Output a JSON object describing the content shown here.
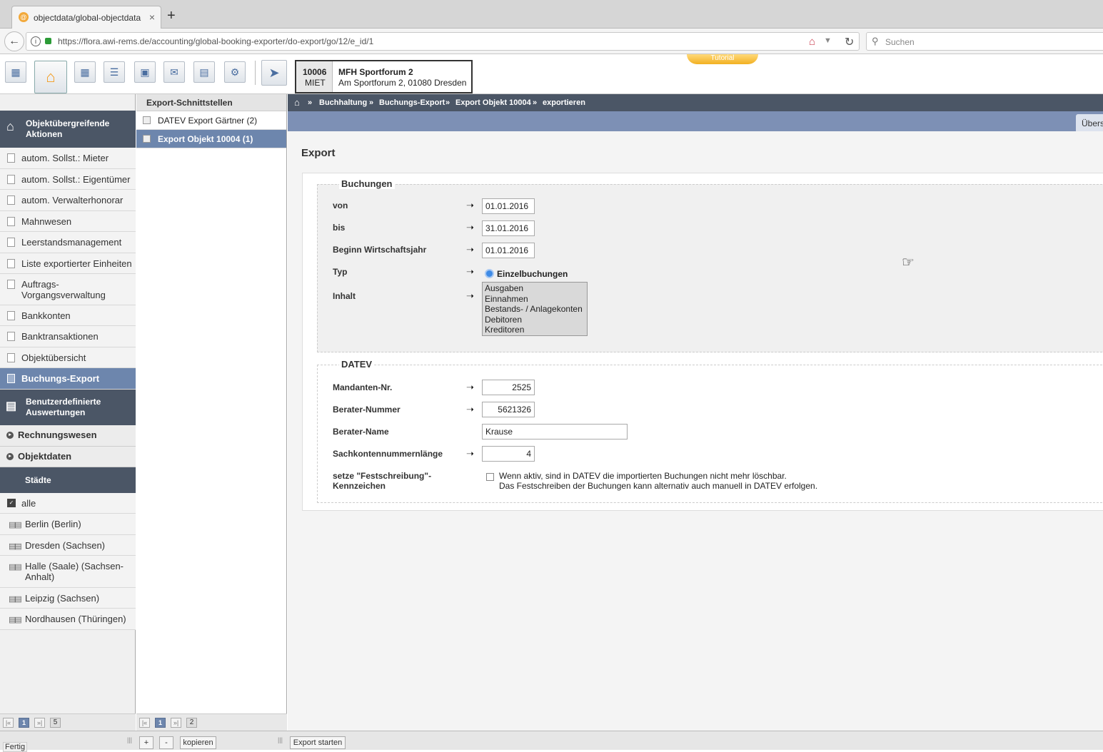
{
  "browser": {
    "tab_title": "objectdata/global-objectdata",
    "tab_close": "×",
    "new_tab": "+",
    "url": "https://flora.awi-rems.de/accounting/global-booking-exporter/do-export/go/12/e_id/1",
    "search_placeholder": "Suchen"
  },
  "toolbar": {
    "tutorial_label": "Tutorial",
    "object": {
      "id": "10006",
      "type": "MIET",
      "name": "MFH Sportforum 2",
      "address": "Am Sportforum 2, 01080 Dresden"
    }
  },
  "leftnav": {
    "group1_title": "Objektübergreifende Aktionen",
    "items": [
      {
        "label": "autom. Sollst.: Mieter"
      },
      {
        "label": "autom. Sollst.: Eigentümer"
      },
      {
        "label": "autom. Verwalterhonorar"
      },
      {
        "label": "Mahnwesen"
      },
      {
        "label": "Leerstandsmanagement"
      },
      {
        "label": "Liste exportierter Einheiten"
      },
      {
        "label": "Auftrags-Vorgangsverwaltung"
      },
      {
        "label": "Bankkonten"
      },
      {
        "label": "Banktransaktionen"
      },
      {
        "label": "Objektübersicht"
      },
      {
        "label": "Buchungs-Export"
      }
    ],
    "group2_title": "Benutzerdefinierte Auswertungen",
    "sections": [
      {
        "label": "Rechnungswesen"
      },
      {
        "label": "Objektdaten"
      }
    ],
    "cities_header": "Städte",
    "cities_all": "alle",
    "cities": [
      {
        "label": "Berlin (Berlin)"
      },
      {
        "label": "Dresden (Sachsen)"
      },
      {
        "label": "Halle (Saale) (Sachsen-Anhalt)"
      },
      {
        "label": "Leipzig (Sachsen)"
      },
      {
        "label": "Nordhausen (Thüringen)"
      }
    ],
    "pager": {
      "first": "|«",
      "current": "1",
      "last": "»|",
      "total": "5"
    }
  },
  "midpanel": {
    "header": "Export-Schnittstellen",
    "items": [
      {
        "label": "DATEV Export Gärtner (2)"
      },
      {
        "label": "Export Objekt 10004 (1)"
      }
    ],
    "pager": {
      "first": "|«",
      "current": "1",
      "last": "»|",
      "total": "2"
    }
  },
  "content": {
    "breadcrumb": [
      "Buchhaltung",
      "Buchungs-Export",
      "Export Objekt 10004",
      "exportieren"
    ],
    "breadcrumb_sep": "»",
    "tab_label": "Übers",
    "title": "Export",
    "buchungen": {
      "legend": "Buchungen",
      "von_label": "von",
      "von_value": "01.01.2016",
      "bis_label": "bis",
      "bis_value": "31.01.2016",
      "beginn_label": "Beginn Wirtschaftsjahr",
      "beginn_value": "01.01.2016",
      "typ_label": "Typ",
      "typ_value": "Einzelbuchungen",
      "inhalt_label": "Inhalt",
      "inhalt_options": [
        "Ausgaben",
        "Einnahmen",
        "Bestands- / Anlagekonten",
        "Debitoren",
        "Kreditoren"
      ]
    },
    "datev": {
      "legend": "DATEV",
      "mandant_label": "Mandanten-Nr.",
      "mandant_value": "2525",
      "berater_nr_label": "Berater-Nummer",
      "berater_nr_value": "5621326",
      "berater_name_label": "Berater-Name",
      "berater_name_value": "Krause",
      "sachkonten_label": "Sachkontennummernlänge",
      "sachkonten_value": "4",
      "fest_label": "setze \"Festschreibung\"-Kennzeichen",
      "fest_note1": "Wenn aktiv, sind in DATEV die importierten Buchungen nicht mehr löschbar.",
      "fest_note2": "Das Festschreiben der Buchungen kann alternativ auch manuell in DATEV erfolgen."
    }
  },
  "bottombar": {
    "status": "Fertig",
    "add_label": "+",
    "remove_label": "-",
    "copy_label": "kopieren",
    "export_label": "Export starten"
  }
}
